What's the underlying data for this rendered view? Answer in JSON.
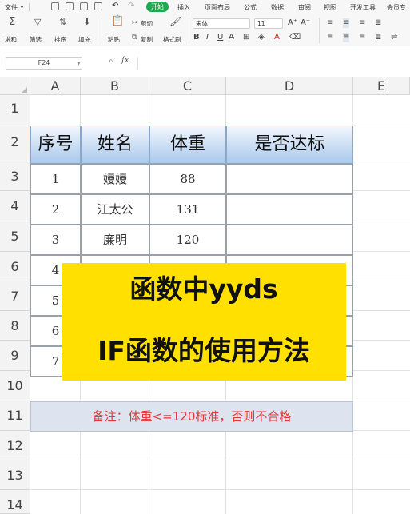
{
  "menu": {
    "file": "文件",
    "start": "开始",
    "insert": "插入",
    "page_layout": "页面布局",
    "formula": "公式",
    "data": "数据",
    "review": "审阅",
    "view": "视图",
    "developer": "开发工具",
    "member": "会员专"
  },
  "ribbon": {
    "sum": "求和",
    "filter": "筛选",
    "sort": "排序",
    "fill": "填充",
    "paste": "粘贴",
    "cut": "剪切",
    "copy": "复制",
    "format_painter": "格式刷",
    "font_name": "宋体",
    "font_size": "11"
  },
  "formula_bar": {
    "cell_ref": "F24",
    "fx": "fx"
  },
  "columns": [
    "A",
    "B",
    "C",
    "D",
    "E"
  ],
  "rows": [
    "1",
    "2",
    "3",
    "4",
    "5",
    "6",
    "7",
    "8",
    "9",
    "10",
    "11",
    "12",
    "13",
    "14"
  ],
  "table": {
    "headers": [
      "序号",
      "姓名",
      "体重",
      "是否达标"
    ],
    "rows": [
      {
        "no": "1",
        "name": "嫚嫚",
        "weight": "88",
        "pass": ""
      },
      {
        "no": "2",
        "name": "江太公",
        "weight": "131",
        "pass": ""
      },
      {
        "no": "3",
        "name": "廉明",
        "weight": "120",
        "pass": ""
      },
      {
        "no": "4",
        "name": "",
        "weight": "",
        "pass": ""
      },
      {
        "no": "5",
        "name": "",
        "weight": "",
        "pass": ""
      },
      {
        "no": "6",
        "name": "",
        "weight": "",
        "pass": ""
      },
      {
        "no": "7",
        "name": "",
        "weight": "",
        "pass": ""
      }
    ]
  },
  "note": "备注：体重<=120标准，否则不合格",
  "banner": {
    "line1": "函数中yyds",
    "line2": "IF函数的使用方法"
  },
  "colors": {
    "accent_green": "#1fa84f",
    "banner_yellow": "#ffe000",
    "header_blue": "#a9c9ec",
    "note_red": "#e23a3a"
  }
}
